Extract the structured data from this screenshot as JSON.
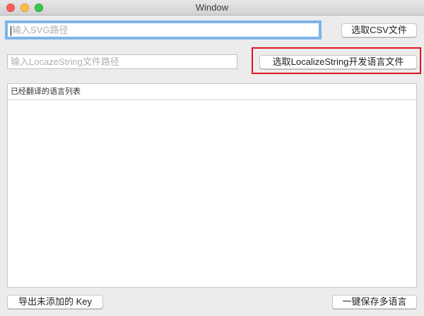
{
  "window": {
    "title": "Window"
  },
  "svg_input": {
    "placeholder": "输入SVG路径"
  },
  "csv_button": "选取CSV文件",
  "localize_input": {
    "placeholder": "输入LocazeString文件路径"
  },
  "localize_button": "选取LocalizeString开发语言文件",
  "table": {
    "header": "已经翻译的语言列表",
    "rows": []
  },
  "export_button": "导出未添加的 Key",
  "save_button": "一键保存多语言",
  "colors": {
    "highlight": "#e0141e",
    "focus": "#7eb4ea"
  }
}
